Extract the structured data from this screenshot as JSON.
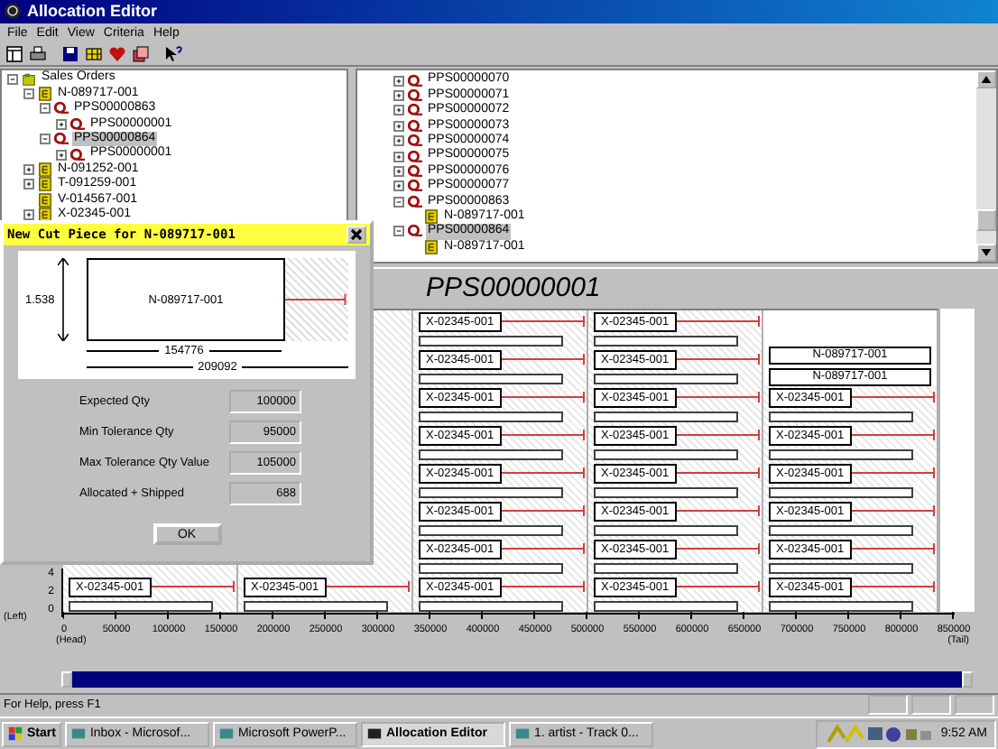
{
  "window": {
    "title": "Allocation Editor"
  },
  "menu": [
    "File",
    "Edit",
    "View",
    "Criteria",
    "Help"
  ],
  "left_tree": [
    {
      "label": "Sales Orders",
      "kind": "folder",
      "expandable": true,
      "expanded": true,
      "selected": false,
      "children": [
        {
          "label": "N-089717-001",
          "kind": "order",
          "expandable": true,
          "expanded": true,
          "selected": false,
          "children": [
            {
              "label": "PPS00000863",
              "kind": "piece",
              "expandable": true,
              "expanded": true,
              "selected": false,
              "children": [
                {
                  "label": "PPS00000001",
                  "kind": "piece",
                  "expandable": true,
                  "expanded": false,
                  "selected": false
                }
              ]
            },
            {
              "label": "PPS00000864",
              "kind": "piece",
              "expandable": true,
              "expanded": true,
              "selected": true,
              "children": [
                {
                  "label": "PPS00000001",
                  "kind": "piece",
                  "expandable": true,
                  "expanded": false,
                  "selected": false
                }
              ]
            }
          ]
        },
        {
          "label": "N-091252-001",
          "kind": "order",
          "expandable": true,
          "expanded": false,
          "selected": false
        },
        {
          "label": "T-091259-001",
          "kind": "order",
          "expandable": true,
          "expanded": false,
          "selected": false
        },
        {
          "label": "V-014567-001",
          "kind": "order",
          "expandable": false,
          "selected": false
        },
        {
          "label": "X-02345-001",
          "kind": "order",
          "expandable": true,
          "expanded": false,
          "selected": false
        }
      ]
    }
  ],
  "right_tree": [
    {
      "label": "PPS00000070",
      "kind": "piece",
      "expandable": true,
      "expanded": false,
      "selected": false
    },
    {
      "label": "PPS00000071",
      "kind": "piece",
      "expandable": true,
      "expanded": false,
      "selected": false
    },
    {
      "label": "PPS00000072",
      "kind": "piece",
      "expandable": true,
      "expanded": false,
      "selected": false
    },
    {
      "label": "PPS00000073",
      "kind": "piece",
      "expandable": true,
      "expanded": false,
      "selected": false
    },
    {
      "label": "PPS00000074",
      "kind": "piece",
      "expandable": true,
      "expanded": false,
      "selected": false
    },
    {
      "label": "PPS00000075",
      "kind": "piece",
      "expandable": true,
      "expanded": false,
      "selected": false
    },
    {
      "label": "PPS00000076",
      "kind": "piece",
      "expandable": true,
      "expanded": false,
      "selected": false
    },
    {
      "label": "PPS00000077",
      "kind": "piece",
      "expandable": true,
      "expanded": false,
      "selected": false
    },
    {
      "label": "PPS00000863",
      "kind": "piece",
      "expandable": true,
      "expanded": true,
      "selected": false,
      "children": [
        {
          "label": "N-089717-001",
          "kind": "order",
          "expandable": false,
          "selected": false
        }
      ]
    },
    {
      "label": "PPS00000864",
      "kind": "piece",
      "expandable": true,
      "expanded": true,
      "selected": true,
      "children": [
        {
          "label": "N-089717-001",
          "kind": "order",
          "expandable": false,
          "selected": false
        }
      ]
    }
  ],
  "range_slider": {
    "level": 1
  },
  "layout": {
    "title": "PPS00000001",
    "y_unit": "(Left)",
    "y_ticks": [
      "4",
      "2",
      "0"
    ],
    "x_ticks": [
      "0",
      "50000",
      "100000",
      "150000",
      "200000",
      "250000",
      "300000",
      "350000",
      "400000",
      "450000",
      "500000",
      "550000",
      "600000",
      "650000",
      "700000",
      "750000",
      "800000",
      "850000"
    ],
    "head_label": "(Head)",
    "tail_label": "(Tail)",
    "rows": [
      {
        "cells": [
          {
            "kind": "covered"
          },
          {
            "kind": "covered"
          },
          {
            "kind": "piece",
            "label": "X-02345-001"
          },
          {
            "kind": "piece",
            "label": "X-02345-001"
          },
          {
            "kind": "empty"
          }
        ]
      },
      {
        "cells": [
          {
            "kind": "covered"
          },
          {
            "kind": "covered"
          },
          {
            "kind": "piece",
            "label": "X-02345-001"
          },
          {
            "kind": "piece",
            "label": "X-02345-001"
          },
          {
            "kind": "order",
            "labels": [
              "N-089717-001",
              "N-089717-001"
            ]
          }
        ]
      },
      {
        "cells": [
          {
            "kind": "covered"
          },
          {
            "kind": "covered"
          },
          {
            "kind": "piece",
            "label": "X-02345-001"
          },
          {
            "kind": "piece",
            "label": "X-02345-001"
          },
          {
            "kind": "piece",
            "label": "X-02345-001"
          }
        ]
      },
      {
        "cells": [
          {
            "kind": "covered"
          },
          {
            "kind": "covered"
          },
          {
            "kind": "piece",
            "label": "X-02345-001"
          },
          {
            "kind": "piece",
            "label": "X-02345-001"
          },
          {
            "kind": "piece",
            "label": "X-02345-001"
          }
        ]
      },
      {
        "cells": [
          {
            "kind": "covered"
          },
          {
            "kind": "covered"
          },
          {
            "kind": "piece",
            "label": "X-02345-001"
          },
          {
            "kind": "piece",
            "label": "X-02345-001"
          },
          {
            "kind": "piece",
            "label": "X-02345-001"
          }
        ]
      },
      {
        "cells": [
          {
            "kind": "covered"
          },
          {
            "kind": "covered"
          },
          {
            "kind": "piece",
            "label": "X-02345-001"
          },
          {
            "kind": "piece",
            "label": "X-02345-001"
          },
          {
            "kind": "piece",
            "label": "X-02345-001"
          }
        ]
      },
      {
        "cells": [
          {
            "kind": "covered"
          },
          {
            "kind": "covered"
          },
          {
            "kind": "piece",
            "label": "X-02345-001"
          },
          {
            "kind": "piece",
            "label": "X-02345-001"
          },
          {
            "kind": "piece",
            "label": "X-02345-001"
          }
        ]
      },
      {
        "cells": [
          {
            "kind": "piece",
            "label": "X-02345-001"
          },
          {
            "kind": "piece",
            "label": "X-02345-001"
          },
          {
            "kind": "piece",
            "label": "X-02345-001"
          },
          {
            "kind": "piece",
            "label": "X-02345-001"
          },
          {
            "kind": "piece",
            "label": "X-02345-001"
          }
        ]
      }
    ]
  },
  "dialog": {
    "title": "New Cut Piece for N-089717-001",
    "height_label": "1.538",
    "piece_label": "N-089717-001",
    "piece_length": "154776",
    "total_length": "209092",
    "fields": [
      {
        "label": "Expected Qty",
        "value": "100000"
      },
      {
        "label": "Min Tolerance Qty",
        "value": "95000"
      },
      {
        "label": "Max Tolerance Qty Value",
        "value": "105000"
      },
      {
        "label": "Allocated + Shipped",
        "value": "688"
      }
    ],
    "button": "OK"
  },
  "status_bar": {
    "text": "For Help, press F1"
  },
  "taskbar": {
    "start": "Start",
    "tasks": [
      {
        "label": "Inbox - Microsof...",
        "selected": false
      },
      {
        "label": "Microsoft PowerP...",
        "selected": false
      },
      {
        "label": "Allocation Editor",
        "selected": true
      },
      {
        "label": "1. artist - Track 0...",
        "selected": false
      }
    ],
    "clock": "9:52 AM"
  }
}
